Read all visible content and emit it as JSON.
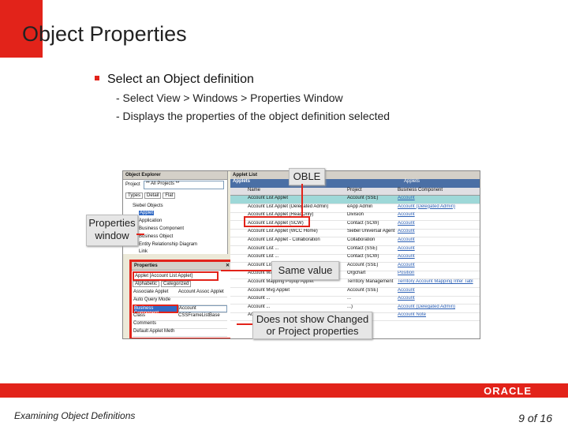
{
  "slide": {
    "title": "Object Properties",
    "bullet": "Select an Object definition",
    "sub1": "- Select View > Windows > Properties Window",
    "sub2": "- Displays the properties of the object definition selected",
    "footer_left": "Examining Object Definitions",
    "footer_right": "9 of 16",
    "logo": "ORACLE"
  },
  "object_explorer": {
    "title": "Object Explorer",
    "project_label": "Project",
    "project_value": "** All Projects **",
    "tabs": [
      "Types",
      "Detail",
      "Flat"
    ],
    "tree": [
      "Siebel Objects",
      "Applet",
      "Application",
      "Business Component",
      "Business Object",
      "Entity Relationship Diagram",
      "Link"
    ]
  },
  "properties": {
    "title": "Properties",
    "selector": "Applet [Account List Applet]",
    "tabs": [
      "Alphabetic",
      "Categorized"
    ],
    "rows": [
      {
        "name": "Associate Applet",
        "value": "Account Assoc Applet"
      },
      {
        "name": "Auto Query Mode",
        "value": ""
      },
      {
        "name": "Business Component",
        "value": "Account"
      },
      {
        "name": "Class",
        "value": "CSSFrameListBase"
      },
      {
        "name": "Comments",
        "value": ""
      },
      {
        "name": "Default Applet Meth",
        "value": ""
      }
    ]
  },
  "applet_list": {
    "tab": "Applet List",
    "bar_left": "Applets",
    "bar_center": "Applets",
    "columns": [
      "Name",
      "Project",
      "Business Component"
    ],
    "rows": [
      {
        "name": "Account List Applet",
        "project": "Account (SSE)",
        "bc": "Account"
      },
      {
        "name": "Account List Applet (Delegated Admin)",
        "project": "eApp Admin",
        "bc": "Account (Delegated Admin)"
      },
      {
        "name": "Account List Applet (ReadOnly)",
        "project": "Division",
        "bc": "Account"
      },
      {
        "name": "Account List Applet (SCW)",
        "project": "Contact (SCW)",
        "bc": "Account"
      },
      {
        "name": "Account List Applet (WCC Home)",
        "project": "Siebel Universal Agent",
        "bc": "Account"
      },
      {
        "name": "Account List Applet - Collaboration",
        "project": "Collaboration",
        "bc": "Account"
      },
      {
        "name": "Account List ...",
        "project": "Contact (SSE)",
        "bc": "Account"
      },
      {
        "name": "Account List ...",
        "project": "Contact (SCW)",
        "bc": "Account"
      },
      {
        "name": "Account List Without Navigation Applet",
        "project": "Account (SSE)",
        "bc": "Account"
      },
      {
        "name": "Account Manager's Tree Applet",
        "project": "Orgchart",
        "bc": "Position"
      },
      {
        "name": "Account Mapping Popup Applet",
        "project": "Territory Management",
        "bc": "Territory Account Mapping Infer Tabl"
      },
      {
        "name": "Account Mvg Applet",
        "project": "Account (SSE)",
        "bc": "Account"
      },
      {
        "name": "Account ...",
        "project": "...",
        "bc": "Account"
      },
      {
        "name": "Account ...",
        "project": "...)",
        "bc": "Account (Delegated Admin)"
      },
      {
        "name": "Account ...",
        "project": "E)",
        "bc": "Account Note"
      }
    ]
  },
  "callouts": {
    "oble": "OBLE",
    "properties_window": "Properties window",
    "same_value": "Same value",
    "not_show": "Does not show Changed or Project properties"
  },
  "colors": {
    "accent": "#e2231a"
  }
}
